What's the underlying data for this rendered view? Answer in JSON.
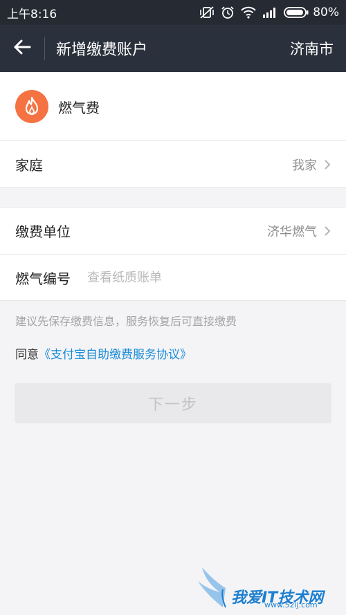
{
  "status_bar": {
    "time": "上午8:16",
    "battery": "80%"
  },
  "nav": {
    "title": "新增缴费账户",
    "city": "济南市"
  },
  "fee_type": {
    "label": "燃气费",
    "icon": "flame-icon",
    "icon_color": "#f57242"
  },
  "family_row": {
    "label": "家庭",
    "value": "我家"
  },
  "unit_row": {
    "label": "缴费单位",
    "value": "济华燃气"
  },
  "number_row": {
    "label": "燃气编号",
    "placeholder": "查看纸质账单",
    "value": ""
  },
  "hint": "建议先保存缴费信息，服务恢复后可直接缴费",
  "agreement": {
    "prefix": "同意",
    "link": "《支付宝自助缴费服务协议》",
    "link_color": "#1a8cd8"
  },
  "next_button": "下一步",
  "watermark": {
    "text": "我爱IT技术网",
    "url": "www.52ij.com"
  }
}
